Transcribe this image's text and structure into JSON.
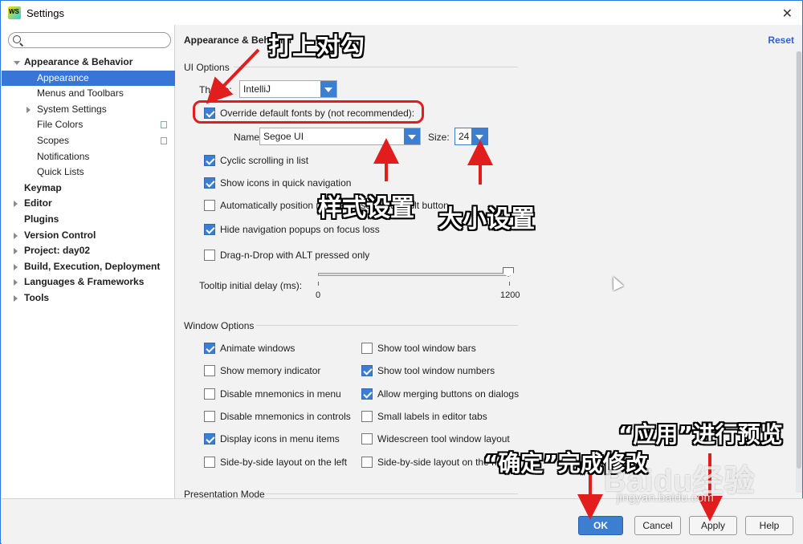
{
  "window": {
    "title": "Settings",
    "close_glyph": "✕"
  },
  "search": {
    "placeholder": ""
  },
  "tree": [
    {
      "label": "Appearance & Behavior",
      "bold": true,
      "arrow": "down",
      "indent": 0
    },
    {
      "label": "Appearance",
      "selected": true,
      "indent": 2
    },
    {
      "label": "Menus and Toolbars",
      "indent": 2
    },
    {
      "label": "System Settings",
      "arrow": "right",
      "indent": 1
    },
    {
      "label": "File Colors",
      "indent": 2,
      "copy": true
    },
    {
      "label": "Scopes",
      "indent": 2,
      "copy": true
    },
    {
      "label": "Notifications",
      "indent": 2
    },
    {
      "label": "Quick Lists",
      "indent": 2
    },
    {
      "label": "Keymap",
      "bold": true,
      "indent": 0
    },
    {
      "label": "Editor",
      "bold": true,
      "arrow": "right",
      "indent": 0
    },
    {
      "label": "Plugins",
      "bold": true,
      "indent": 0
    },
    {
      "label": "Version Control",
      "bold": true,
      "arrow": "right",
      "indent": 0
    },
    {
      "label": "Project: day02",
      "bold": true,
      "arrow": "right",
      "indent": 0
    },
    {
      "label": "Build, Execution, Deployment",
      "bold": true,
      "arrow": "right",
      "indent": 0
    },
    {
      "label": "Languages & Frameworks",
      "bold": true,
      "arrow": "right",
      "indent": 0
    },
    {
      "label": "Tools",
      "bold": true,
      "arrow": "right",
      "indent": 0
    }
  ],
  "content": {
    "breadcrumb": "Appearance & Behavior",
    "reset": "Reset",
    "ui_options_title": "UI Options",
    "theme_label": "Theme:",
    "theme_value": "IntelliJ",
    "override_fonts": {
      "label": "Override default fonts by (not recommended):",
      "checked": true
    },
    "font_name_label": "Name:",
    "font_name_value": "Segoe UI",
    "font_size_label": "Size:",
    "font_size_value": "24",
    "ui_checkboxes": [
      {
        "label": "Cyclic scrolling in list",
        "checked": true
      },
      {
        "label": "Show icons in quick navigation",
        "checked": true
      },
      {
        "label": "Automatically position mouse cursor on default button",
        "checked": false
      },
      {
        "label": "Hide navigation popups on focus loss",
        "checked": true
      },
      {
        "label": "Drag-n-Drop with ALT pressed only",
        "checked": false
      }
    ],
    "tooltip_label": "Tooltip initial delay (ms):",
    "tooltip_min": "0",
    "tooltip_max": "1200",
    "tooltip_value": 1200,
    "window_options_title": "Window Options",
    "window_left": [
      {
        "label": "Animate windows",
        "checked": true
      },
      {
        "label": "Show memory indicator",
        "checked": false
      },
      {
        "label": "Disable mnemonics in menu",
        "checked": false
      },
      {
        "label": "Disable mnemonics in controls",
        "checked": false
      },
      {
        "label": "Display icons in menu items",
        "checked": true
      },
      {
        "label": "Side-by-side layout on the left",
        "checked": false
      }
    ],
    "window_right": [
      {
        "label": "Show tool window bars",
        "checked": false
      },
      {
        "label": "Show tool window numbers",
        "checked": true
      },
      {
        "label": "Allow merging buttons on dialogs",
        "checked": true
      },
      {
        "label": "Small labels in editor tabs",
        "checked": false
      },
      {
        "label": "Widescreen tool window layout",
        "checked": false
      },
      {
        "label": "Side-by-side layout on the right",
        "checked": false
      }
    ],
    "presentation_title": "Presentation Mode"
  },
  "buttons": {
    "ok": "OK",
    "cancel": "Cancel",
    "apply": "Apply",
    "help": "Help"
  },
  "annotations": {
    "check_it": "打上对勾",
    "style_setting": "样式设置",
    "size_setting": "大小设置",
    "apply_preview": "“应用”进行预览",
    "ok_finish": "“确定”完成修改",
    "arrow_color": "#e11d1d"
  },
  "watermark": {
    "main": "Baidu经验",
    "sub": "jingyan.baidu.com"
  }
}
